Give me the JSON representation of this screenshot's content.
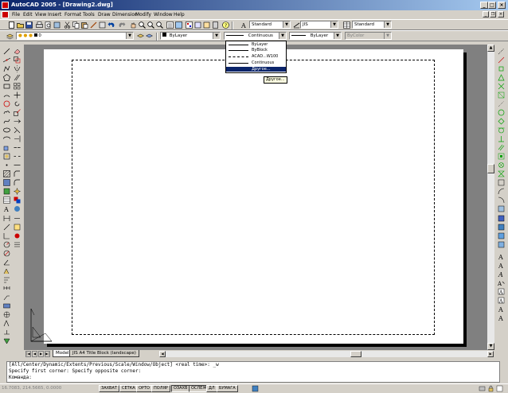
{
  "titlebar": {
    "title": "AutoCAD 2005 - [Drawing2.dwg]"
  },
  "menu": [
    "File",
    "Edit",
    "View",
    "Insert",
    "Format",
    "Tools",
    "Draw",
    "Dimension",
    "Modify",
    "Window",
    "Help"
  ],
  "styles_toolbar": {
    "text_style": "Standard",
    "dim_style": "JIS",
    "table_style": "Standard"
  },
  "layers_toolbar": {
    "layer": "0"
  },
  "properties_toolbar": {
    "color": "ByLayer",
    "linetype": "Continuous",
    "lineweight": "ByLayer",
    "plotstyle": "ByColor"
  },
  "linetype_dropdown": {
    "items": [
      "ByLayer",
      "ByBlock",
      "ACAD...W100",
      "Continuous",
      "Другое..."
    ],
    "selected_index": 4
  },
  "tooltip": "Другое...",
  "layout_tabs": [
    "Model",
    "JIS A4 Title Block (landscape)"
  ],
  "active_tab_index": 0,
  "command_lines": [
    "[All/Center/Dynamic/Extents/Previous/Scale/Window/Object] <real time>: _w",
    "Specify first corner: Specify opposite corner:",
    "Команда:"
  ],
  "status": {
    "coords": "16.7083, 214.5665, 0.0000",
    "toggles": [
      "ЗАХВАТ",
      "СЕТКА",
      "ОРТО",
      "ПОЛЯР",
      "ОЗАХВ",
      "ОСЛЕЖ",
      "ДЛ",
      "БУМАГА"
    ]
  }
}
